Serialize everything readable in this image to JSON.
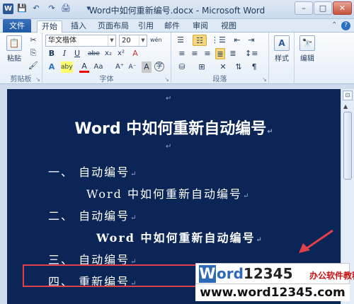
{
  "window": {
    "title": "Word中如何重新编号.docx - Microsoft Word",
    "app_icon_letter": "W",
    "controls": {
      "minimize": "–",
      "maximize": "□",
      "close": "✕"
    }
  },
  "quick_access": {
    "save": "💾",
    "undo": "↶",
    "redo": "↷",
    "print": "🖨",
    "customize": "▾"
  },
  "tabs": {
    "file": "文件",
    "items": [
      "开始",
      "插入",
      "页面布局",
      "引用",
      "邮件",
      "审阅",
      "视图"
    ],
    "active": "开始",
    "help": "?"
  },
  "ribbon": {
    "clipboard": {
      "label": "剪贴板",
      "paste": "粘贴",
      "cut": "✂",
      "copy": "⎘",
      "format_painter": "🖌"
    },
    "font": {
      "label": "字体",
      "font_name": "华文楷体",
      "font_size": "20",
      "phonetic": "wén",
      "bold": "B",
      "italic": "I",
      "underline": "U",
      "strike": "abe",
      "subscript": "x₂",
      "superscript": "x²",
      "clear": "A",
      "text_effect": "A",
      "highlight": "aby",
      "font_color": "A",
      "change_case": "Aa",
      "grow": "A⁺",
      "shrink": "A⁻",
      "char_shading": "A",
      "enclose": "字"
    },
    "paragraph": {
      "label": "段落"
    },
    "styles": {
      "label": "样式",
      "icon": "A"
    },
    "editing": {
      "label": "编辑",
      "icon": "🔭"
    },
    "colors": {
      "accent": "#2b5797",
      "pressed": "#f8d67e"
    }
  },
  "document": {
    "page_color": "#0b2557",
    "title": "Word 中如何重新自动编号",
    "lines": [
      {
        "text": "一、  自动编号"
      },
      {
        "text": "Word 中如何重新自动编号"
      },
      {
        "text": "二、  自动编号"
      },
      {
        "text": "Word 中如何重新自动编号"
      },
      {
        "text": "三、  自动编号"
      },
      {
        "text": "四、  重新编号"
      }
    ],
    "para_mark": "↵"
  },
  "annotation": {
    "box_color": "#e0404a"
  },
  "watermark": {
    "logo_letter": "W",
    "logo_rest": "ord",
    "logo_numbers": "12345",
    "tagline": "办公软件教程",
    "url": "www.word12345.com"
  }
}
